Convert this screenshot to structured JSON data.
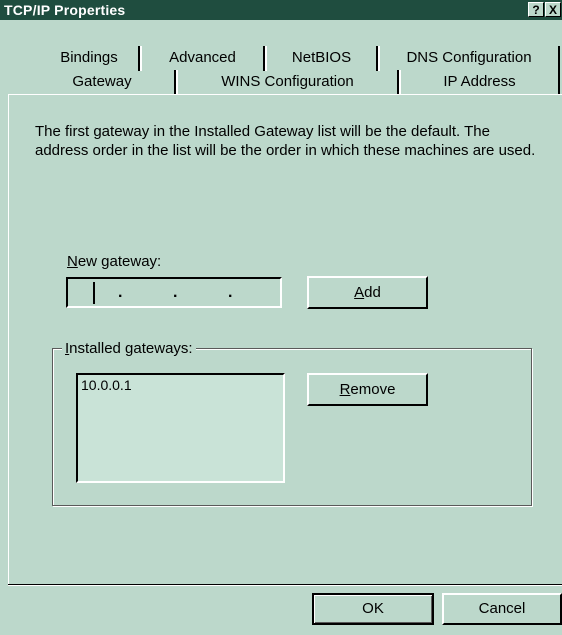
{
  "window": {
    "title": "TCP/IP Properties",
    "help_glyph": "?",
    "close_glyph": "X"
  },
  "tabs": {
    "back_row": [
      "Bindings",
      "Advanced",
      "NetBIOS",
      "DNS Configuration"
    ],
    "front_row": [
      "Gateway",
      "WINS Configuration",
      "IP Address"
    ],
    "selected": "Gateway"
  },
  "gateway_page": {
    "description": "The first gateway in the Installed Gateway list will be the default. The address order in the list will be the order in which these machines are used.",
    "new_gateway_label_mnemonic": "N",
    "new_gateway_label_rest": "ew gateway:",
    "ip_dots": [
      ".",
      ".",
      "."
    ],
    "add_button_mnemonic": "A",
    "add_button_rest": "dd",
    "installed_label_mnemonic": "I",
    "installed_label_rest": "nstalled gateways:",
    "installed_gateways": [
      "10.0.0.1"
    ],
    "remove_button_mnemonic": "R",
    "remove_button_rest": "emove"
  },
  "footer": {
    "ok_label": "OK",
    "cancel_label": "Cancel"
  },
  "colors": {
    "titlebar": "#1f4d3f",
    "face": "#bcd8cb",
    "list_bg": "#c9e3d7"
  }
}
